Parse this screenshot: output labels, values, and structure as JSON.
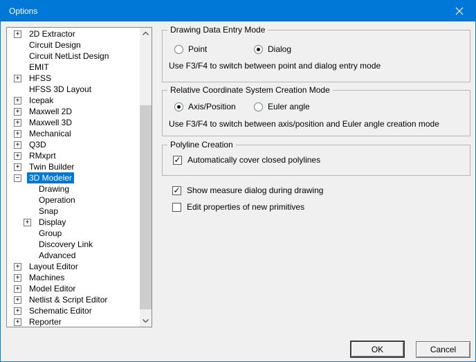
{
  "window": {
    "title": "Options"
  },
  "colors": {
    "titlebar": "#0078d7",
    "selection": "#0078d7",
    "dialog_bg": "#f0f0f0",
    "tree_bg": "#ffffff"
  },
  "icons": {
    "close": "close-icon",
    "scroll_up": "chevron-up-icon",
    "scroll_down": "chevron-down-icon",
    "expand": "plus-box-icon",
    "collapse": "minus-box-icon"
  },
  "tree": {
    "items": [
      {
        "label": "2D Extractor",
        "expand": "plus",
        "level": 0,
        "selected": false
      },
      {
        "label": "Circuit Design",
        "expand": "none",
        "level": 0,
        "selected": false
      },
      {
        "label": "Circuit NetList Design",
        "expand": "none",
        "level": 0,
        "selected": false
      },
      {
        "label": "EMIT",
        "expand": "none",
        "level": 0,
        "selected": false
      },
      {
        "label": "HFSS",
        "expand": "plus",
        "level": 0,
        "selected": false
      },
      {
        "label": "HFSS 3D Layout",
        "expand": "none",
        "level": 0,
        "selected": false
      },
      {
        "label": "Icepak",
        "expand": "plus",
        "level": 0,
        "selected": false
      },
      {
        "label": "Maxwell 2D",
        "expand": "plus",
        "level": 0,
        "selected": false
      },
      {
        "label": "Maxwell 3D",
        "expand": "plus",
        "level": 0,
        "selected": false
      },
      {
        "label": "Mechanical",
        "expand": "plus",
        "level": 0,
        "selected": false
      },
      {
        "label": "Q3D",
        "expand": "plus",
        "level": 0,
        "selected": false
      },
      {
        "label": "RMxprt",
        "expand": "plus",
        "level": 0,
        "selected": false
      },
      {
        "label": "Twin Builder",
        "expand": "plus",
        "level": 0,
        "selected": false
      },
      {
        "label": "3D Modeler",
        "expand": "minus",
        "level": 0,
        "selected": true
      },
      {
        "label": "Drawing",
        "expand": "none",
        "level": 1,
        "selected": false
      },
      {
        "label": "Operation",
        "expand": "none",
        "level": 1,
        "selected": false
      },
      {
        "label": "Snap",
        "expand": "none",
        "level": 1,
        "selected": false
      },
      {
        "label": "Display",
        "expand": "plus",
        "level": 1,
        "selected": false
      },
      {
        "label": "Group",
        "expand": "none",
        "level": 1,
        "selected": false
      },
      {
        "label": "Discovery Link",
        "expand": "none",
        "level": 1,
        "selected": false
      },
      {
        "label": "Advanced",
        "expand": "none",
        "level": 1,
        "selected": false
      },
      {
        "label": "Layout Editor",
        "expand": "plus",
        "level": 0,
        "selected": false
      },
      {
        "label": "Machines",
        "expand": "plus",
        "level": 0,
        "selected": false
      },
      {
        "label": "Model Editor",
        "expand": "plus",
        "level": 0,
        "selected": false
      },
      {
        "label": "Netlist & Script Editor",
        "expand": "plus",
        "level": 0,
        "selected": false
      },
      {
        "label": "Schematic Editor",
        "expand": "plus",
        "level": 0,
        "selected": false
      },
      {
        "label": "Reporter",
        "expand": "plus",
        "level": 0,
        "selected": false
      }
    ]
  },
  "panels": {
    "drawing_entry": {
      "title": "Drawing Data Entry Mode",
      "options": [
        {
          "label": "Point",
          "selected": false
        },
        {
          "label": "Dialog",
          "selected": true
        }
      ],
      "note": "Use F3/F4 to switch between point and dialog entry mode"
    },
    "rcs": {
      "title": "Relative Coordinate System Creation Mode",
      "options": [
        {
          "label": "Axis/Position",
          "selected": true
        },
        {
          "label": "Euler angle",
          "selected": false
        }
      ],
      "note": "Use F3/F4 to switch between axis/position and Euler angle creation mode"
    },
    "polyline": {
      "title": "Polyline Creation",
      "checkbox": {
        "label": "Automatically cover closed polylines",
        "checked": true
      }
    },
    "checkboxes": [
      {
        "label": "Show measure dialog during drawing",
        "checked": true
      },
      {
        "label": "Edit properties of new primitives",
        "checked": false
      }
    ]
  },
  "buttons": {
    "ok": "OK",
    "cancel": "Cancel"
  },
  "glyphs": {
    "check": "✓"
  }
}
